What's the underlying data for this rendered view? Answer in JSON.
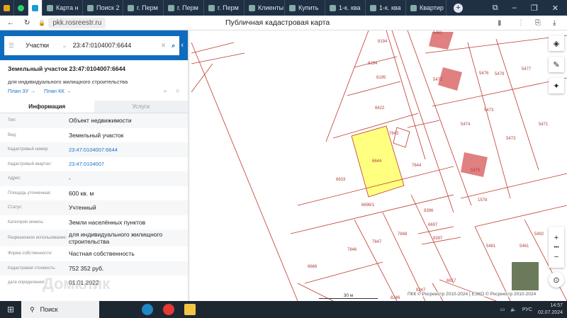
{
  "browser": {
    "tabs": [
      "Карта н",
      "Поиск 2",
      "г. Перм",
      "г. Перм",
      "г. Перм",
      "Клиенты",
      "Купить",
      "1-к. ква",
      "1-к. ква",
      "Квартир"
    ],
    "url": "pkk.rosreestr.ru",
    "page_title": "Публичная кадастровая карта"
  },
  "search": {
    "type": "Участки",
    "query": "23:47:0104007:6644"
  },
  "object": {
    "title": "Земельный участок 23:47:0104007:6644",
    "subtitle": "для индивидуального жилищного строительства",
    "link_plan_zu": "План ЗУ →",
    "link_plan_kk": "План КК →",
    "tabs": [
      "Информация",
      "Услуги"
    ],
    "rows": [
      {
        "label": "Тип:",
        "value": "Объект недвижимости"
      },
      {
        "label": "Вид:",
        "value": "Земельный участок"
      },
      {
        "label": "Кадастровый номер:",
        "value": "23:47:0104007:6644",
        "link": true
      },
      {
        "label": "Кадастровый квартал:",
        "value": "23:47:0104007",
        "link": true
      },
      {
        "label": "Адрес:",
        "value": "-"
      },
      {
        "label": "Площадь уточненная:",
        "value": "600 кв. м"
      },
      {
        "label": "Статус:",
        "value": "Учтенный"
      },
      {
        "label": "Категория земель:",
        "value": "Земли населённых пунктов"
      },
      {
        "label": "Разрешенное использование:",
        "value": "для индивидуального жилищного строительства"
      },
      {
        "label": "Форма собственности:",
        "value": "Частная собственность"
      },
      {
        "label": "Кадастровая стоимость:",
        "value": "752 352 руб."
      },
      {
        "label": "дата определения:",
        "value": "01.01.2022"
      }
    ]
  },
  "map": {
    "parcels": [
      "8194",
      "8194",
      "8195",
      "6622",
      "6644",
      "7643",
      "7644",
      "6633",
      "6696/1",
      "8396",
      "6697",
      "8397",
      "7848",
      "7846",
      "7847",
      "6666",
      "6617",
      "8247",
      "8246",
      "5461",
      "5472",
      "5476",
      "5477",
      "5479",
      "5473",
      "5474",
      "5473",
      "5471",
      "5475",
      "1578",
      "5481",
      "5492",
      "5461"
    ],
    "scale": "30 м",
    "copyright": "ПКК © Росреестр 2010-2024 | ЕЭКО © Росреестр 2010-2024",
    "highlight_color": "#ffff80",
    "line_color": "#c0392b"
  },
  "taskbar": {
    "search": "Поиск",
    "lang": "РУС",
    "time": "14:57",
    "date": "02.07.2024"
  },
  "watermark": "Домклик"
}
